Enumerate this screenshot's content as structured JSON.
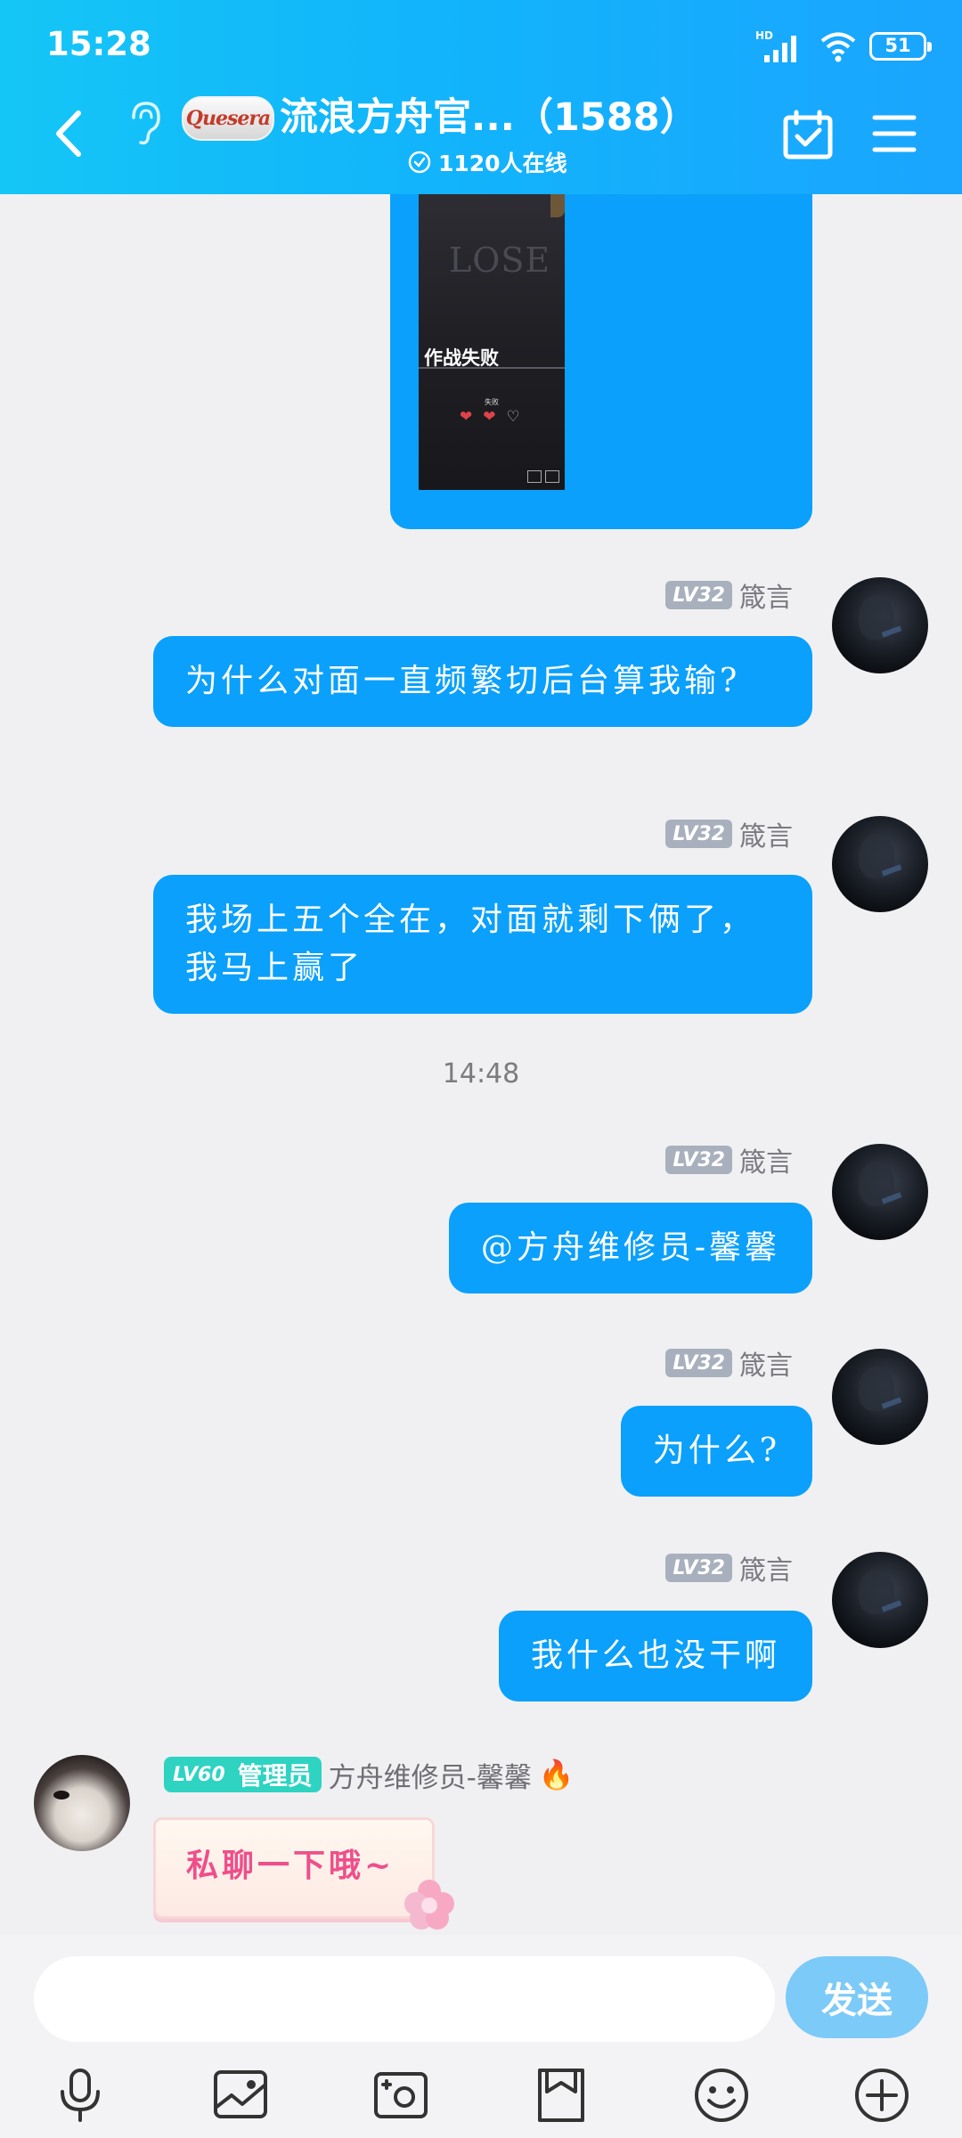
{
  "status_bar": {
    "time": "15:28",
    "battery": "51"
  },
  "header": {
    "group_badge": "Quesera",
    "title": "流浪方舟官...（1588）",
    "online": "1120人在线"
  },
  "image_message": {
    "thumb_lose": "LOSE",
    "thumb_fail": "作战失败",
    "thumb_small": "失败"
  },
  "messages": [
    {
      "sender": "箴言",
      "level": "LV32",
      "text": "为什么对面一直频繁切后台算我输?"
    },
    {
      "sender": "箴言",
      "level": "LV32",
      "text": "我场上五个全在，对面就剩下俩了，我马上赢了"
    },
    {
      "time_separator": "14:48"
    },
    {
      "sender": "箴言",
      "level": "LV32",
      "text": "@方舟维修员-馨馨"
    },
    {
      "sender": "箴言",
      "level": "LV32",
      "text": "为什么?"
    },
    {
      "sender": "箴言",
      "level": "LV32",
      "text": "我什么也没干啊"
    }
  ],
  "admin_message": {
    "level": "LV60",
    "role": "管理员",
    "sender": "方舟维修员-馨馨",
    "sticker_text": "私聊一下哦~"
  },
  "composer": {
    "placeholder": "",
    "send_label": "发送"
  },
  "colors": {
    "header_start": "#14c6f6",
    "header_end": "#1aa5ff",
    "bubble": "#0aa0fb",
    "send": "#7ccaf7",
    "admin_tag": "#2ed3c2"
  },
  "toolbar_icons": [
    "mic-icon",
    "image-icon",
    "camera-icon",
    "file-icon",
    "emoji-icon",
    "plus-icon"
  ]
}
